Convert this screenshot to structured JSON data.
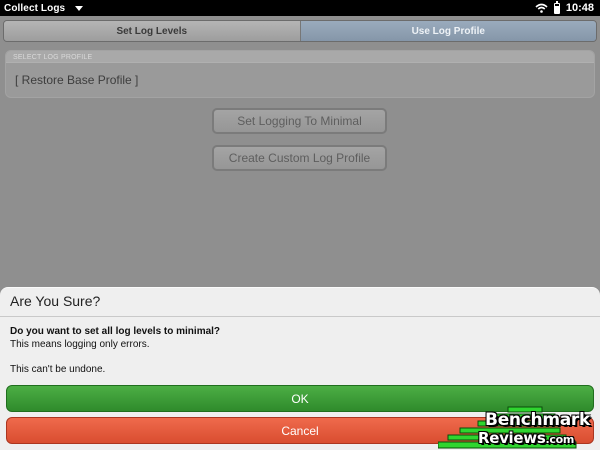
{
  "status_bar": {
    "app_title": "Collect Logs",
    "time": "10:48",
    "icons": {
      "menu": "chevron-down-icon",
      "wifi": "wifi-icon",
      "battery": "battery-icon"
    }
  },
  "tabs": [
    {
      "label": "Set Log Levels",
      "active": false
    },
    {
      "label": "Use Log Profile",
      "active": true
    }
  ],
  "log_profile": {
    "header": "SELECT LOG PROFILE",
    "value": "[ Restore Base Profile ]"
  },
  "actions": {
    "minimal_label": "Set Logging To Minimal",
    "custom_label": "Create Custom Log Profile"
  },
  "dialog": {
    "title": "Are You Sure?",
    "question": "Do you want to set all log levels to minimal?",
    "detail": "This means logging only errors.",
    "warning": "This can't be undone.",
    "ok_label": "OK",
    "cancel_label": "Cancel"
  },
  "watermark": {
    "line1": "Benchmark",
    "line2_name": "Reviews",
    "line2_suffix": ".com"
  },
  "colors": {
    "ok": "#3a9b36",
    "cancel": "#e35a3c",
    "active_tab": "#8fa1b4",
    "watermark_green": "#2fd52f"
  }
}
